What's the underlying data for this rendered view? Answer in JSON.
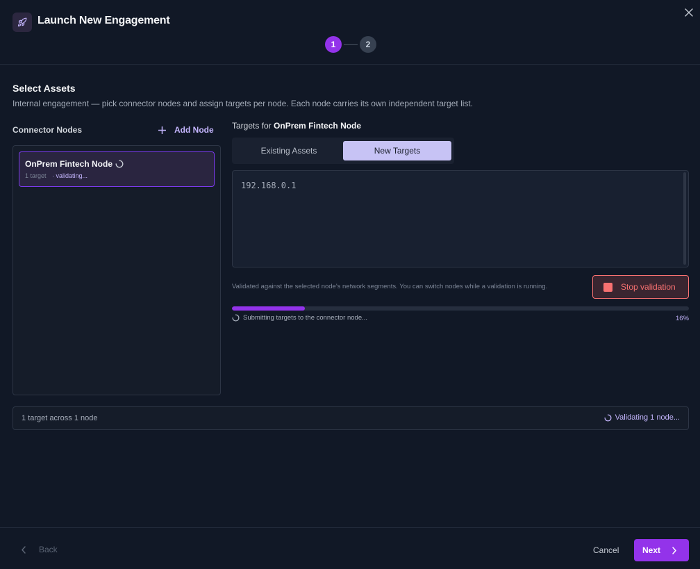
{
  "header": {
    "title": "Launch New Engagement",
    "steps": [
      "1",
      "2"
    ],
    "active_step": 1
  },
  "main": {
    "section_title": "Select Assets",
    "section_description": "Internal engagement — pick connector nodes and assign targets per node. Each node carries its own independent target list.",
    "nodes_label": "Connector Nodes",
    "add_node_label": "Add Node",
    "nodes": [
      {
        "name": "OnPrem Fintech Node",
        "target_count": "1 target",
        "status": "· validating..."
      }
    ],
    "targets_prefix": "Targets for",
    "selected_node": "OnPrem Fintech Node",
    "tabs": [
      {
        "label": "Existing Assets",
        "active": false
      },
      {
        "label": "New Targets",
        "active": true
      }
    ],
    "targets_value": "192.168.0.1",
    "helper_text": "Validated against the selected node's network segments. You can switch nodes while a validation is running.",
    "stop_button_label": "Stop validation",
    "progress": {
      "fraction": 0.16,
      "status": "Submitting targets to the connector node...",
      "percent_label": "16%"
    },
    "summary": {
      "left": "1 target across 1 node",
      "right": "Validating 1 node..."
    }
  },
  "footer": {
    "back_label": "Back",
    "cancel_label": "Cancel",
    "next_label": "Next"
  },
  "colors": {
    "accent": "#9333ea",
    "accent_light": "#c4b5fd",
    "danger": "#f87171",
    "background": "#111826"
  },
  "icons": {
    "app": "rocket-icon",
    "close": "close-icon",
    "add": "plus-icon",
    "loading": "spinner-icon",
    "stop": "stop-icon",
    "back": "chevron-left-icon",
    "next": "chevron-right-icon"
  }
}
